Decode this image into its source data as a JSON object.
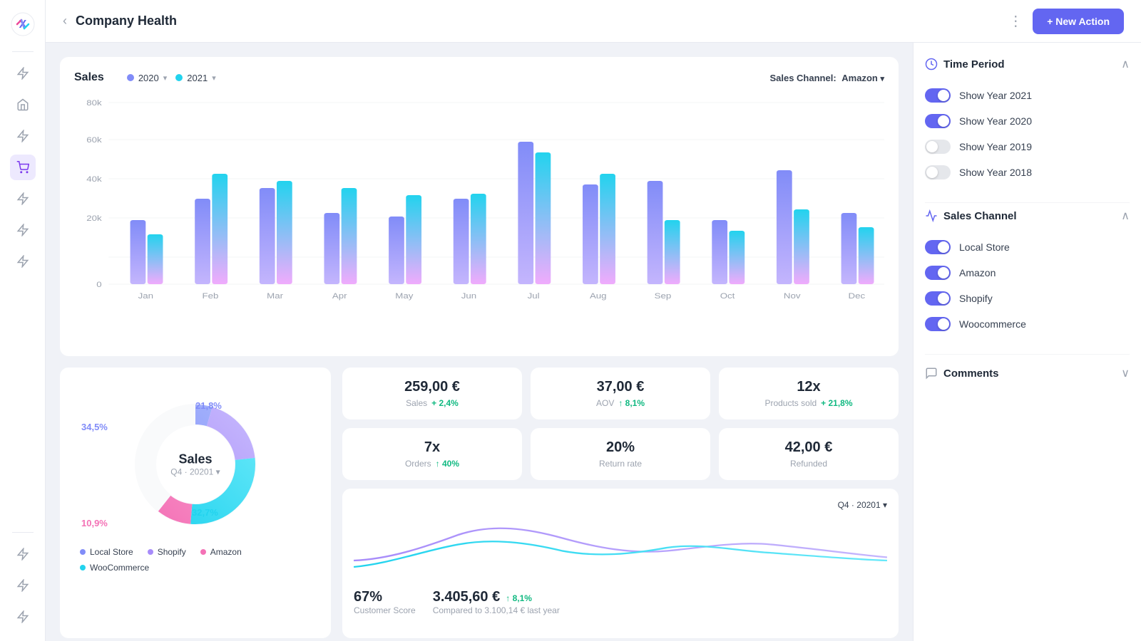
{
  "app": {
    "logo": "X",
    "title": "Company Health",
    "new_action_label": "+ New Action"
  },
  "sidebar_icons": [
    {
      "name": "bolt-icon",
      "active": false
    },
    {
      "name": "home-icon",
      "active": false
    },
    {
      "name": "bolt2-icon",
      "active": false
    },
    {
      "name": "cart-icon",
      "active": true
    },
    {
      "name": "bolt3-icon",
      "active": false
    },
    {
      "name": "bolt4-icon",
      "active": false
    },
    {
      "name": "bolt5-icon",
      "active": false
    }
  ],
  "sales_chart": {
    "title": "Sales",
    "year1": "2020",
    "year2": "2021",
    "channel_label": "Sales Channel:",
    "channel_value": "Amazon",
    "y_labels": [
      "80k",
      "60k",
      "40k",
      "20k",
      "0"
    ],
    "x_labels": [
      "Jan",
      "Feb",
      "Mar",
      "Apr",
      "May",
      "Jun",
      "Jul",
      "Aug",
      "Sep",
      "Oct",
      "Nov",
      "Dec"
    ]
  },
  "donut": {
    "center_title": "Sales",
    "center_sub": "Q4 · 20201 ▾",
    "segments": [
      {
        "label": "Local Store",
        "color": "#818cf8",
        "pct": "34,5%",
        "value": 34.5
      },
      {
        "label": "Shopify",
        "color": "#a78bfa",
        "pct": "21,8%",
        "value": 21.8
      },
      {
        "label": "WooCommerce",
        "color": "#22d3ee",
        "pct": "32,7%",
        "value": 32.7
      },
      {
        "label": "Amazon",
        "color": "#f472b6",
        "pct": "10,9%",
        "value": 10.9
      }
    ]
  },
  "metrics": [
    {
      "value": "259,00 €",
      "label": "Sales",
      "change": "+ 2,4%",
      "positive": true
    },
    {
      "value": "37,00 €",
      "label": "AOV",
      "change": "↑ 8,1%",
      "positive": true
    },
    {
      "value": "12x",
      "label": "Products sold",
      "change": "+ 21,8%",
      "positive": true
    },
    {
      "value": "7x",
      "label": "Orders",
      "change": "↑ 40%",
      "positive": true
    },
    {
      "value": "20%",
      "label": "Return rate",
      "change": "",
      "positive": true
    },
    {
      "value": "42,00 €",
      "label": "Refunded",
      "change": "",
      "positive": false
    }
  ],
  "line_chart": {
    "period": "Q4 · 20201 ▾",
    "customer_score_value": "67%",
    "customer_score_label": "Customer Score",
    "revenue_value": "3.405,60 €",
    "revenue_change": "↑ 8,1%",
    "revenue_sub": "Compared to 3.100,14 € last year"
  },
  "right_sidebar": {
    "time_period": {
      "title": "Time Period",
      "items": [
        {
          "label": "Show Year 2021",
          "on": true
        },
        {
          "label": "Show Year 2020",
          "on": true
        },
        {
          "label": "Show Year 2019",
          "on": false
        },
        {
          "label": "Show Year 2018",
          "on": false
        }
      ]
    },
    "sales_channel": {
      "title": "Sales Channel",
      "items": [
        {
          "label": "Local Store",
          "on": true
        },
        {
          "label": "Amazon",
          "on": true
        },
        {
          "label": "Shopify",
          "on": true
        },
        {
          "label": "Woocommerce",
          "on": true
        }
      ]
    },
    "comments": {
      "title": "Comments"
    }
  }
}
